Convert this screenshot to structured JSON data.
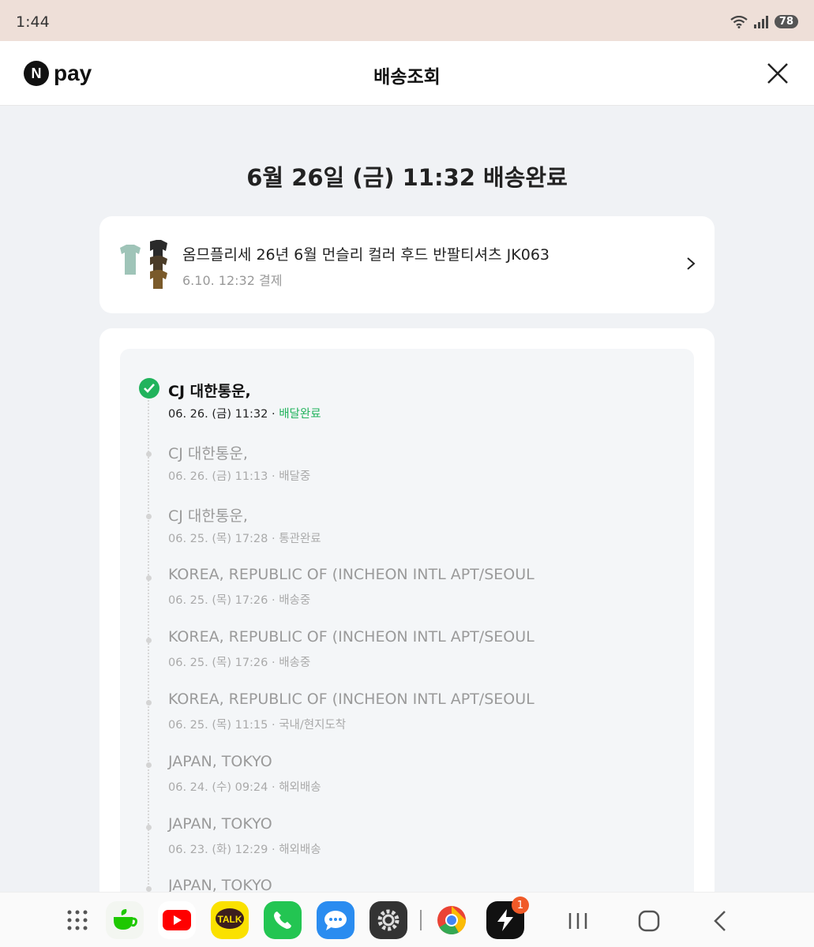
{
  "status_bar": {
    "time": "1:44",
    "battery": "78"
  },
  "header": {
    "brand": "pay",
    "brand_mark": "N",
    "title": "배송조회"
  },
  "main": {
    "title": "6월 26일 (금) 11:32 배송완료"
  },
  "product": {
    "name": "옴므플리세 26년 6월 먼슬리 컬러 후드 반팔티셔츠 JK063",
    "paid_at": "6.10. 12:32 결제"
  },
  "tracking": {
    "events": [
      {
        "location": "CJ 대한통운,",
        "datetime": "06. 26. (금) 11:32",
        "status": "배달완료",
        "active": true
      },
      {
        "location": "CJ 대한통운,",
        "datetime": "06. 26. (금) 11:13",
        "status": "배달중"
      },
      {
        "location": "CJ 대한통운,",
        "datetime": "06. 25. (목) 17:28",
        "status": "통관완료"
      },
      {
        "location": "KOREA, REPUBLIC OF (INCHEON INTL APT/SEOUL",
        "datetime": "06. 25. (목) 17:26",
        "status": "배송중"
      },
      {
        "location": "KOREA, REPUBLIC OF (INCHEON INTL APT/SEOUL",
        "datetime": "06. 25. (목) 17:26",
        "status": "배송중"
      },
      {
        "location": "KOREA, REPUBLIC OF (INCHEON INTL APT/SEOUL",
        "datetime": "06. 25. (목) 11:15",
        "status": "국내/현지도착"
      },
      {
        "location": "JAPAN, TOKYO",
        "datetime": "06. 24. (수) 09:24",
        "status": "해외배송"
      },
      {
        "location": "JAPAN, TOKYO",
        "datetime": "06. 23. (화) 12:29",
        "status": "해외배송"
      },
      {
        "location": "JAPAN, TOKYO",
        "datetime": "",
        "status": ""
      }
    ]
  },
  "navbar": {
    "apps": [
      {
        "icon": "apps-grid-icon"
      },
      {
        "icon": "naver-cafe-icon",
        "color": "#1ec800"
      },
      {
        "icon": "youtube-icon",
        "color": "#ff0000"
      },
      {
        "icon": "kakaotalk-icon",
        "color": "#fae100",
        "label": "TALK"
      },
      {
        "icon": "phone-icon",
        "color": "#23c552"
      },
      {
        "icon": "messages-icon",
        "color": "#2a8cf0"
      },
      {
        "icon": "settings-icon",
        "color": "#333333"
      },
      {
        "icon": "chrome-icon"
      },
      {
        "icon": "bolt-app-icon",
        "color": "#111111",
        "badge": "1"
      }
    ]
  }
}
